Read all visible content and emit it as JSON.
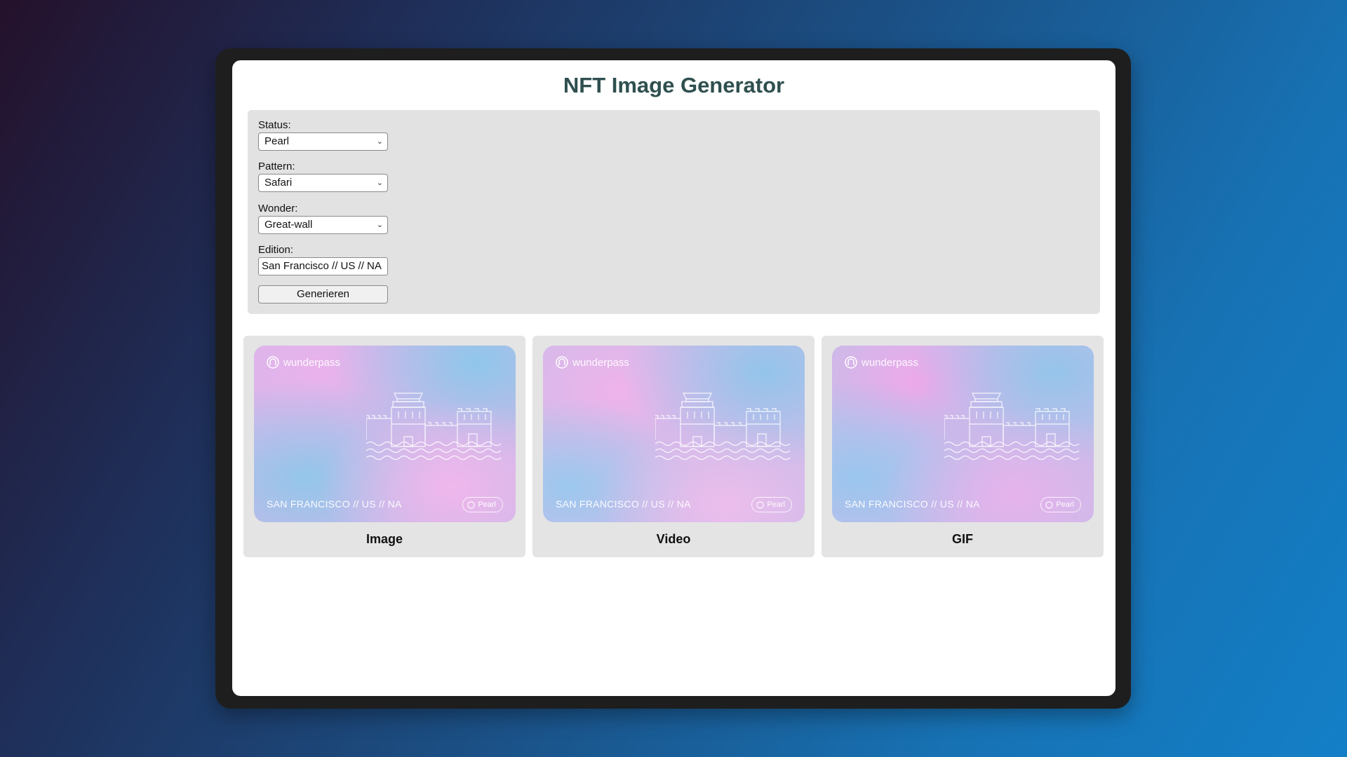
{
  "app": {
    "title": "NFT Image Generator"
  },
  "form": {
    "status": {
      "label": "Status:",
      "value": "Pearl"
    },
    "pattern": {
      "label": "Pattern:",
      "value": "Safari"
    },
    "wonder": {
      "label": "Wonder:",
      "value": "Great-wall"
    },
    "edition": {
      "label": "Edition:",
      "value": "San Francisco // US // NA"
    },
    "generate_label": "Generieren"
  },
  "nft": {
    "brand": "wunderpass",
    "edition_text": "SAN FRANCISCO // US // NA",
    "status_badge": "Pearl"
  },
  "results": [
    {
      "caption": "Image"
    },
    {
      "caption": "Video"
    },
    {
      "caption": "GIF"
    }
  ],
  "colors": {
    "title": "#2f4f4f",
    "panel": "#e2e2e2",
    "card_pink": "#e8b6ea",
    "card_blue": "#9cc6ea"
  }
}
